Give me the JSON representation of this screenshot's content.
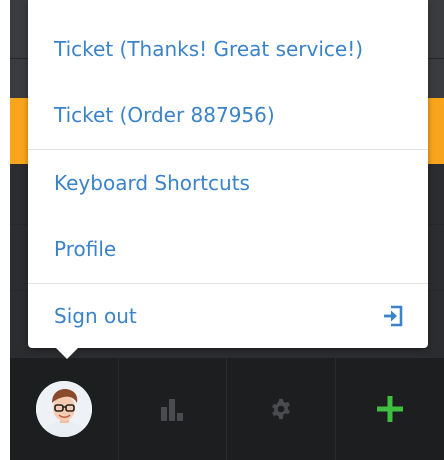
{
  "menu": {
    "items": [
      {
        "label": "Ticket (Thanks! Great service!)"
      },
      {
        "label": "Ticket (Order 887956)"
      },
      {
        "label": "Keyboard Shortcuts"
      },
      {
        "label": "Profile"
      },
      {
        "label": "Sign out",
        "icon": "sign-out-icon"
      }
    ]
  },
  "bottombar": {
    "items": [
      {
        "icon": "user-avatar"
      },
      {
        "icon": "stats-bar-chart-icon"
      },
      {
        "icon": "gear-icon"
      },
      {
        "icon": "plus-icon"
      }
    ]
  },
  "colors": {
    "link": "#3b83c8",
    "accent_orange": "#f9a51c",
    "plus_green": "#3fbf3f",
    "bar_dark": "#1d1e20"
  }
}
